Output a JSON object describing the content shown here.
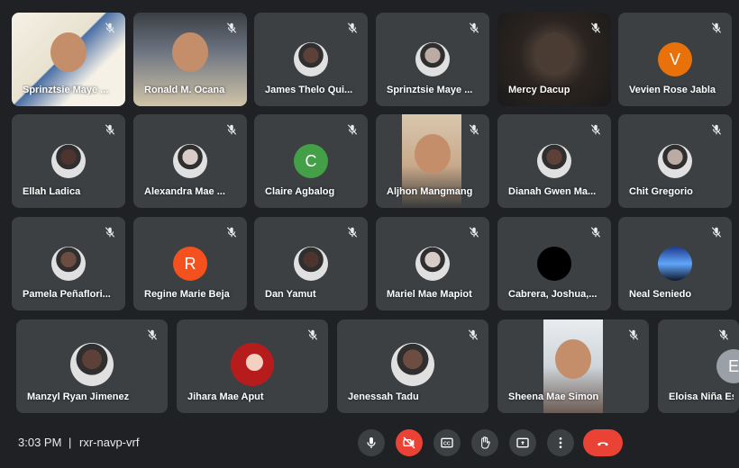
{
  "participants": [
    {
      "name": "Sprinztsie Maye ...",
      "kind": "video",
      "scene": "classroom"
    },
    {
      "name": "Ronald M. Ocana",
      "kind": "video",
      "scene": "room"
    },
    {
      "name": "James Thelo Qui...",
      "kind": "photo"
    },
    {
      "name": "Sprinztsie Maye ...",
      "kind": "photo"
    },
    {
      "name": "Mercy Dacup",
      "kind": "video",
      "scene": "dark"
    },
    {
      "name": "Vevien Rose Jabla",
      "kind": "initial",
      "initial": "V",
      "color": "#e8710a"
    },
    {
      "name": "Ellah Ladica",
      "kind": "photo"
    },
    {
      "name": "Alexandra Mae ...",
      "kind": "photo"
    },
    {
      "name": "Claire Agbalog",
      "kind": "initial",
      "initial": "C",
      "color": "#43a047"
    },
    {
      "name": "Aljhon Mangmang",
      "kind": "video",
      "scene": "selfie"
    },
    {
      "name": "Dianah Gwen Ma...",
      "kind": "photo"
    },
    {
      "name": "Chit Gregorio",
      "kind": "photo"
    },
    {
      "name": "Pamela Peñaflori...",
      "kind": "photo"
    },
    {
      "name": "Regine Marie Beja",
      "kind": "initial",
      "initial": "R",
      "color": "#f4511e"
    },
    {
      "name": "Dan Yamut",
      "kind": "photo"
    },
    {
      "name": "Mariel Mae Mapiot",
      "kind": "photo"
    },
    {
      "name": "Cabrera, Joshua,...",
      "kind": "photo"
    },
    {
      "name": "Neal Seniedo",
      "kind": "photo"
    },
    {
      "name": "Manzyl Ryan Jimenez",
      "kind": "photo"
    },
    {
      "name": "Jihara Mae Aput",
      "kind": "photo"
    },
    {
      "name": "Jenessah Tadu",
      "kind": "photo"
    },
    {
      "name": "Sheena Mae Simon",
      "kind": "video",
      "scene": "selfie2"
    },
    {
      "name": "Eloisa Niña Esc",
      "kind": "initial",
      "initial": "E",
      "color": "#9aa0a6"
    }
  ],
  "bottom_bar": {
    "time": "3:03 PM",
    "separator": "|",
    "meeting_code": "rxr-navp-vrf"
  },
  "controls": [
    {
      "name": "microphone-button",
      "icon": "mic-icon"
    },
    {
      "name": "camera-button",
      "icon": "camera-off-icon"
    },
    {
      "name": "captions-button",
      "icon": "captions-icon"
    },
    {
      "name": "raise-hand-button",
      "icon": "hand-icon"
    },
    {
      "name": "present-button",
      "icon": "present-icon"
    },
    {
      "name": "more-options-button",
      "icon": "more-icon"
    },
    {
      "name": "leave-call-button",
      "icon": "end-call-icon"
    }
  ],
  "colors": {
    "background": "#202124",
    "tile": "#3c4043",
    "danger": "#ea4335"
  }
}
